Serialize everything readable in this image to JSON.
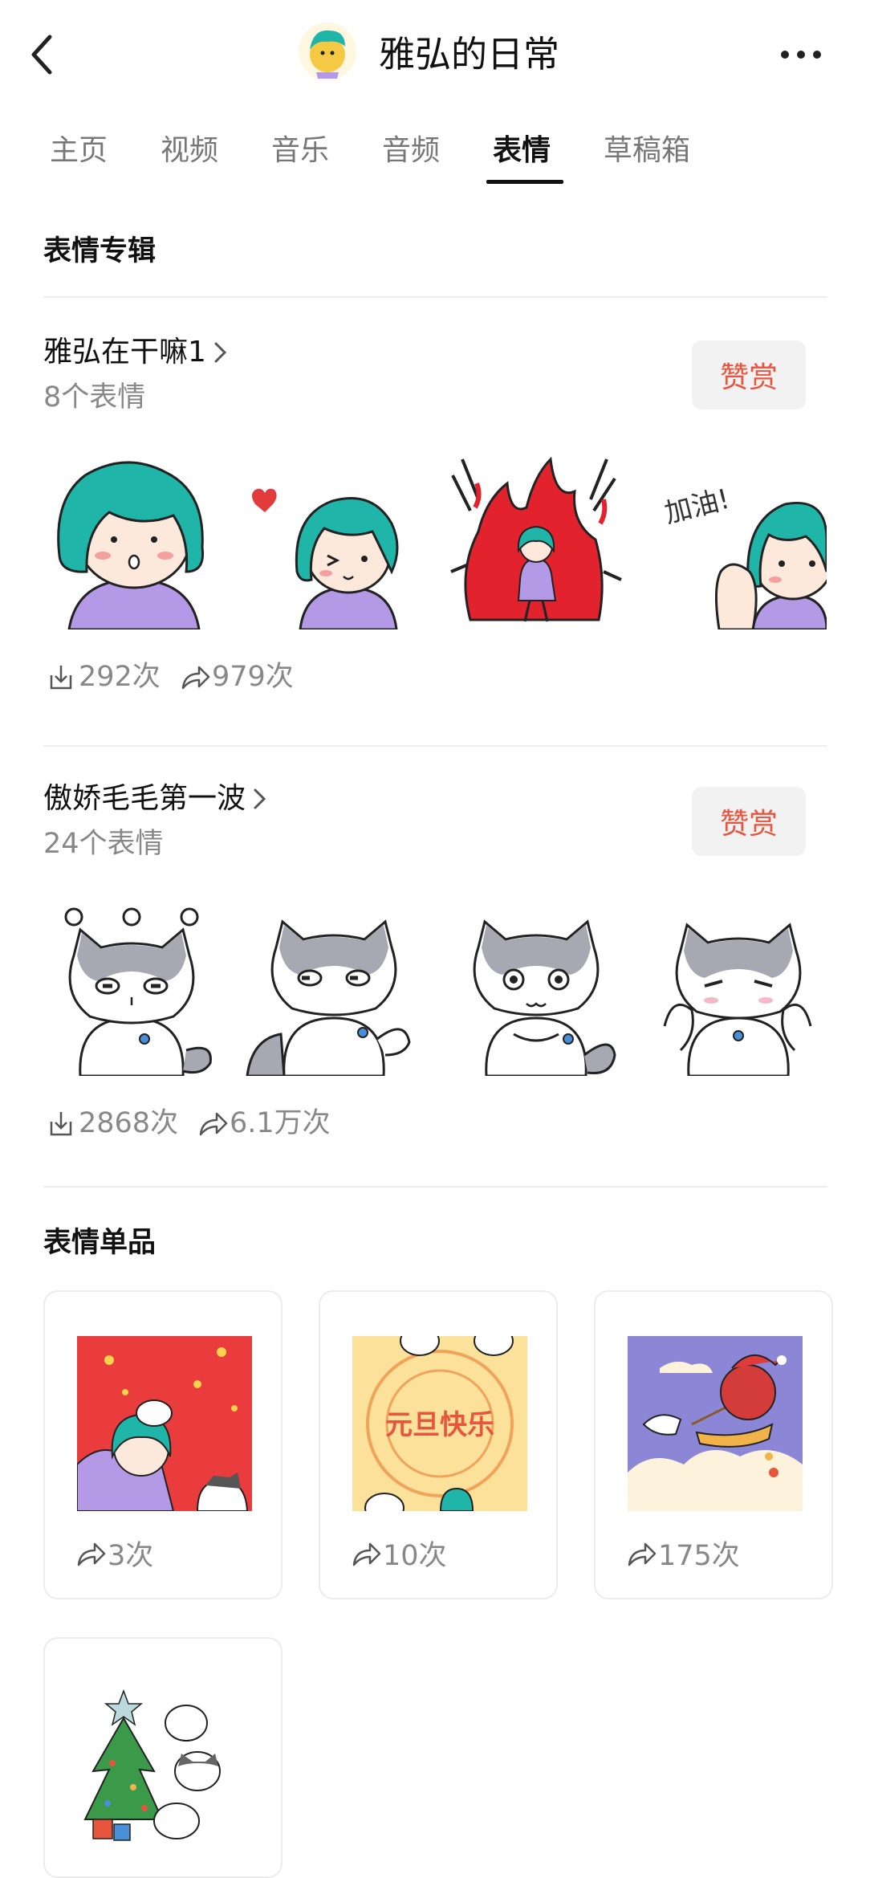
{
  "header": {
    "title": "雅弘的日常",
    "back_icon": "back-arrow-icon",
    "more_icon": "more-dots-icon"
  },
  "tabs": [
    {
      "label": "主页",
      "active": false
    },
    {
      "label": "视频",
      "active": false
    },
    {
      "label": "音乐",
      "active": false
    },
    {
      "label": "音频",
      "active": false
    },
    {
      "label": "表情",
      "active": true
    },
    {
      "label": "草稿箱",
      "active": false
    }
  ],
  "albums_section": {
    "title": "表情专辑",
    "albums": [
      {
        "name": "雅弘在干嘛1",
        "count": "8个表情",
        "reward_label": "赞赏",
        "downloads": "292次",
        "shares": "979次"
      },
      {
        "name": "傲娇毛毛第一波",
        "count": "24个表情",
        "reward_label": "赞赏",
        "downloads": "2868次",
        "shares": "6.1万次"
      }
    ]
  },
  "singles_section": {
    "title": "表情单品",
    "items": [
      {
        "shares": "3次"
      },
      {
        "shares": "10次",
        "image_text": "元旦快乐"
      },
      {
        "shares": "175次"
      },
      {
        "shares": ""
      }
    ]
  },
  "sticker_text": {
    "cheer": "加油!"
  },
  "colors": {
    "accent_red": "#e8553f",
    "tab_active": "#111111",
    "text_secondary": "#888888",
    "hair_teal": "#1fb5a8",
    "shirt_purple": "#b49ae6"
  }
}
